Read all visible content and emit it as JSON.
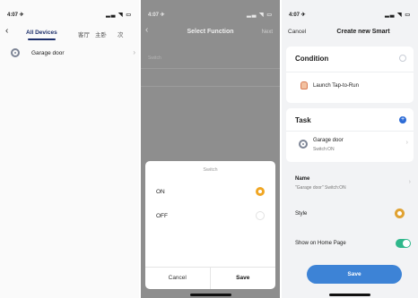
{
  "panel1": {
    "status": {
      "time": "4:07 ✈",
      "icons": "▂▃ ◥ ▭"
    },
    "tabs": [
      "All Devices",
      "客厅",
      "主卧",
      "次"
    ],
    "device": "Garage door"
  },
  "panel2": {
    "status": {
      "time": "4:07 ✈",
      "icons": "▂▃ ◥ ▭"
    },
    "header": {
      "title": "Select Function",
      "next": "Next"
    },
    "background_items": [
      "Switch"
    ],
    "sheet": {
      "title": "Switch",
      "options": [
        {
          "label": "ON",
          "selected": true
        },
        {
          "label": "OFF",
          "selected": false
        }
      ],
      "cancel": "Cancel",
      "save": "Save"
    }
  },
  "panel3": {
    "status": {
      "time": "4:07 ✈",
      "icons": "▂▃ ◥ ▭"
    },
    "header": {
      "cancel": "Cancel",
      "title": "Create new Smart"
    },
    "condition": {
      "title": "Condition",
      "item": "Launch Tap-to-Run"
    },
    "task": {
      "title": "Task",
      "device": "Garage door",
      "action": "Switch:ON"
    },
    "name": {
      "label": "Name",
      "value": "\"Garage door\" Switch:ON"
    },
    "style": {
      "label": "Style"
    },
    "show_home": {
      "label": "Show on Home Page",
      "enabled": true
    },
    "save": "Save"
  },
  "colors": {
    "accent_blue": "#3d83d6",
    "radio_orange": "#f0a623",
    "toggle_green": "#2fb78b",
    "tab_active": "#1d2f6b"
  }
}
